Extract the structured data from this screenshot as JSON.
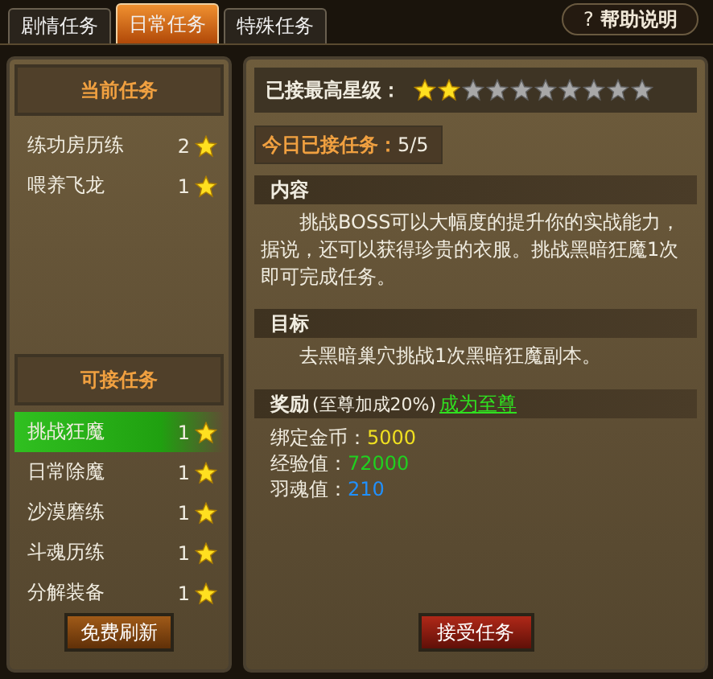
{
  "tabs": [
    {
      "label": "剧情任务",
      "selected": false
    },
    {
      "label": "日常任务",
      "selected": true
    },
    {
      "label": "特殊任务",
      "selected": false
    }
  ],
  "help_button": {
    "icon": "?",
    "label": "帮助说明"
  },
  "current_tasks": {
    "title": "当前任务",
    "items": [
      {
        "name": "练功房历练",
        "star_count": "2"
      },
      {
        "name": "喂养飞龙",
        "star_count": "1"
      }
    ]
  },
  "available_tasks": {
    "title": "可接任务",
    "items": [
      {
        "name": "挑战狂魔",
        "star_count": "1",
        "selected": true
      },
      {
        "name": "日常除魔",
        "star_count": "1",
        "selected": false
      },
      {
        "name": "沙漠磨练",
        "star_count": "1",
        "selected": false
      },
      {
        "name": "斗魂历练",
        "star_count": "1",
        "selected": false
      },
      {
        "name": "分解装备",
        "star_count": "1",
        "selected": false
      }
    ],
    "refresh_button": "免费刷新"
  },
  "star_level": {
    "label": "已接最高星级：",
    "stars": 2
  },
  "today": {
    "label": "今日已接任务：",
    "value": "5/5"
  },
  "content": {
    "title": "内容",
    "text": "挑战BOSS可以大幅度的提升你的实战能力，据说，还可以获得珍贵的衣服。挑战黑暗狂魔1次即可完成任务。"
  },
  "goal": {
    "title": "目标",
    "text": "去黑暗巢穴挑战1次黑暗狂魔副本。"
  },
  "reward": {
    "title": "奖励",
    "bonus": "(至尊加成20%)",
    "link": "成为至尊",
    "items": [
      {
        "label": "绑定金币：",
        "value": "5000",
        "color": "#f0e020"
      },
      {
        "label": "经验值：",
        "value": "72000",
        "color": "#20d020"
      },
      {
        "label": "羽魂值：",
        "value": "210",
        "color": "#2090ff"
      }
    ]
  },
  "accept_button": "接受任务"
}
